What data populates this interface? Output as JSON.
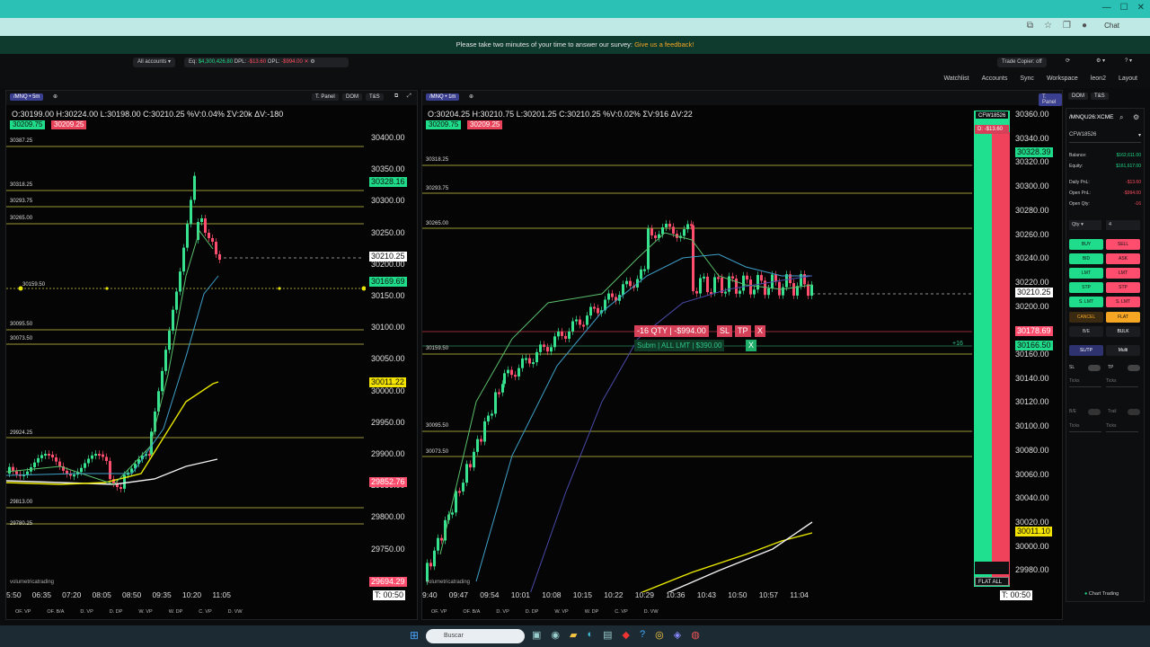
{
  "browser": {
    "chat_label": "Chat"
  },
  "survey": {
    "text": "Please take two minutes of your time to answer our survey: ",
    "link": "Give us a feedback!"
  },
  "accounts": {
    "selector": "All accounts",
    "eq_label": "Eq:",
    "eq_value": "$4,300,426.80",
    "dpl_label": "DPL:",
    "dpl_value": "-$13.60",
    "opl_label": "OPL:",
    "opl_value": "-$994.00",
    "trade_copier": "Trade Copier: off"
  },
  "nav": {
    "items": [
      "Watchlist",
      "Accounts",
      "Sync",
      "Workspace",
      "leon2",
      "Layout"
    ]
  },
  "chart_left": {
    "symbol": "/MNQ • 5m",
    "buttons": [
      "T. Panel",
      "DOM",
      "T&S"
    ],
    "ohlc": "O:30199.00  H:30224.00  L:30198.00  C:30210.25  %V:0.04%  ΣV:20k  ΔV:-180",
    "bid_tag": "30209.75",
    "ask_tag": "30209.25",
    "levels": [
      {
        "label": "30387.25",
        "yfrac": 0.0
      },
      {
        "label": "30318.25"
      },
      {
        "label": "30293.75"
      },
      {
        "label": "30265.00"
      },
      {
        "label": "30159.50"
      },
      {
        "label": "30095.50"
      },
      {
        "label": "30073.50"
      },
      {
        "label": "29924.25"
      },
      {
        "label": "29813.00"
      },
      {
        "label": "29780.25"
      }
    ],
    "axis": [
      "30400.00",
      "30350.00",
      "30300.00",
      "30250.00",
      "30200.00",
      "30150.00",
      "30100.00",
      "30050.00",
      "30000.00",
      "29950.00",
      "29900.00",
      "29850.00",
      "29800.00",
      "29750.00",
      "29700.00"
    ],
    "axis_tags": [
      {
        "text": "30328.16",
        "color": "#1fdc8a"
      },
      {
        "text": "30210.25",
        "color": "#ffffff"
      },
      {
        "text": "30169.69",
        "color": "#1fdc8a"
      },
      {
        "text": "30011.22",
        "color": "#f2e300"
      },
      {
        "text": "29852.76",
        "color": "#ff4d6d"
      },
      {
        "text": "29694.29",
        "color": "#ff4d6d"
      }
    ],
    "times": [
      "5:50",
      "06:35",
      "07:20",
      "08:05",
      "08:50",
      "09:35",
      "10:20",
      "11:05"
    ],
    "timer": "T: 00:50",
    "brand": "volumetricatrading",
    "tools": [
      "OF. VP",
      "OF. B/A",
      "D. VP",
      "D. DP",
      "W. VP",
      "W. DP",
      "C. VP",
      "D. VW"
    ]
  },
  "chart_right": {
    "symbol": "/MNQ • 1m",
    "buttons": [
      "T. Panel",
      "DOM",
      "T&S"
    ],
    "ohlc": "O:30204.25  H:30210.75  L:30201.25  C:30210.25  %V:0.02%  ΣV:916  ΔV:22",
    "bid_tag": "30209.75",
    "ask_tag": "30209.25",
    "levels": [
      "30318.25",
      "30293.75",
      "30265.00",
      "30159.50",
      "30095.50",
      "30073.50"
    ],
    "axis": [
      "30360.00",
      "30340.00",
      "30320.00",
      "30300.00",
      "30280.00",
      "30260.00",
      "30240.00",
      "30220.00",
      "30200.00",
      "30180.00",
      "30160.00",
      "30140.00",
      "30120.00",
      "30100.00",
      "30080.00",
      "30060.00",
      "30040.00",
      "30020.00",
      "30000.00",
      "29980.00"
    ],
    "axis_tags": [
      {
        "text": "30328.39",
        "color": "#1fdc8a"
      },
      {
        "text": "30210.25",
        "color": "#ffffff"
      },
      {
        "text": "30178.69",
        "color": "#ff4d6d"
      },
      {
        "text": "30166.50",
        "color": "#1fdc8a"
      },
      {
        "text": "30011.10",
        "color": "#f2e300"
      }
    ],
    "position": {
      "qty": "-16 QTY",
      "pnl": "-$994.00",
      "sl": "SL",
      "tp": "TP",
      "x": "X"
    },
    "order": {
      "text": "Subm | ALL LMT | $390.00",
      "x": "X",
      "qty": "+16"
    },
    "dom_account": "CFW18526",
    "dom_pnl": "D: -$13.60",
    "flat_all": "FLAT ALL",
    "times": [
      "9:40",
      "09:47",
      "09:54",
      "10:01",
      "10:08",
      "10:15",
      "10:22",
      "10:29",
      "10:36",
      "10:43",
      "10:50",
      "10:57",
      "11:04"
    ],
    "timer": "T: 00:50",
    "brand": "volumetricatrading",
    "tools": [
      "OF. VP",
      "OF. B/A",
      "D. VP",
      "D. DP",
      "W. VP",
      "W. DP",
      "C. VP",
      "D. VW"
    ]
  },
  "sidebar": {
    "symbol": "/MNQU26:XCME",
    "account": "CFW18526",
    "balance_label": "Balance:",
    "balance": "$162,611.00",
    "equity_label": "Equity:",
    "equity": "$161,617.00",
    "daily_label": "Daily PnL:",
    "daily": "-$13.60",
    "open_label": "Open PnL:",
    "open": "-$994.00",
    "openqty_label": "Open Qty:",
    "openqty": "-16",
    "qty_label": "Qty",
    "qty_value": "4",
    "buttons": [
      {
        "l": "BUY",
        "r": "SELL"
      },
      {
        "l": "BID",
        "r": "ASK"
      },
      {
        "l": "LMT",
        "r": "LMT"
      },
      {
        "l": "STP",
        "r": "STP"
      },
      {
        "l": "S. LMT",
        "r": "S. LMT"
      }
    ],
    "cancel": "CANCEL",
    "flat": "FLAT",
    "be": "B/E",
    "bulk": "BULK",
    "sltp": "SL/TP",
    "multi": "Multi",
    "sl": "SL",
    "tp": "TP",
    "ticks": "Ticks",
    "be2": "B/E",
    "trail": "Trail",
    "chart_trading": "Chart Trading"
  },
  "taskbar": {
    "search": "Buscar"
  }
}
